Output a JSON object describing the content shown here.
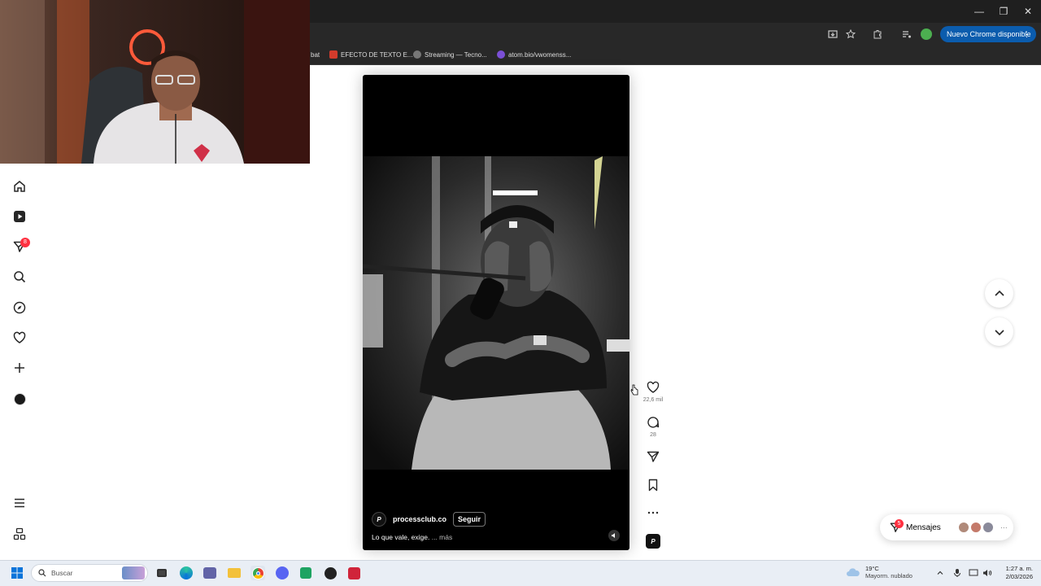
{
  "browser": {
    "update_pill": "Nuevo Chrome disponible",
    "bookmarks": [
      {
        "label": "bat",
        "color": "#555555"
      },
      {
        "label": "EFECTO DE TEXTO E...",
        "color": "#d33b2c"
      },
      {
        "label": "Streaming — Tecno...",
        "color": "#777777"
      },
      {
        "label": "atom.bio/vwomenss...",
        "color": "#7b4fd6"
      }
    ]
  },
  "sidebar": {
    "notification_count": "8",
    "items": [
      "home-icon",
      "reels-icon",
      "direct-icon",
      "search-icon",
      "explore-icon",
      "notifications-icon",
      "create-icon",
      "profile-avatar"
    ],
    "bottom_items": [
      "more-menu-icon",
      "also-from-meta-icon"
    ]
  },
  "reel": {
    "owner": "processclub.co",
    "follow_label": "Seguir",
    "caption": "Lo que vale, exige.",
    "more_label": "... más"
  },
  "actions": {
    "likes": "22,6 mil",
    "comments": "28"
  },
  "messages": {
    "label": "Mensajes",
    "badge": "5"
  },
  "taskbar": {
    "search_placeholder": "Buscar",
    "temperature": "19°C",
    "weather": "Mayorm. nublado",
    "time": "1:27 a. m.",
    "date": "2/03/2026"
  },
  "colors": {
    "accent": "#0b5cad",
    "badge": "#ff3040",
    "icon": "#262626"
  }
}
